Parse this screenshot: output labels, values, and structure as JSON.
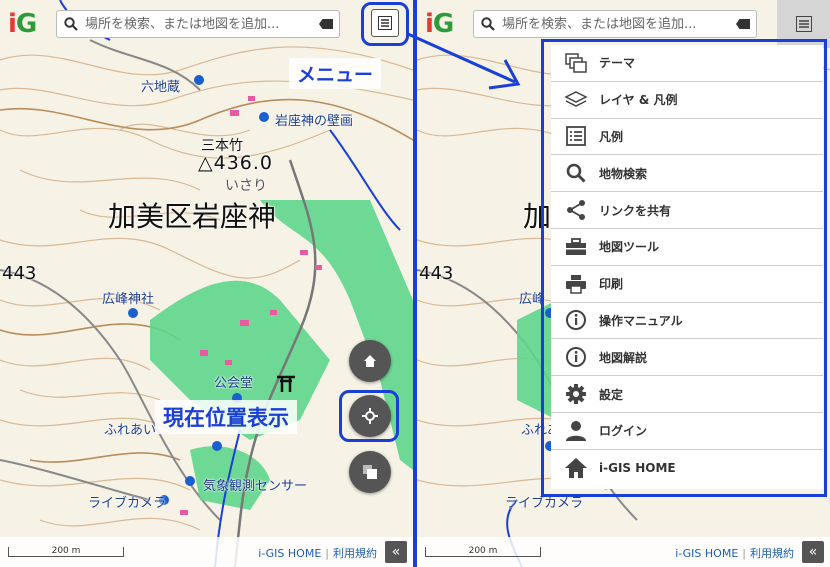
{
  "app": {
    "logo_i": "i",
    "logo_g": "G"
  },
  "search": {
    "placeholder": "場所を検索、または地図を追加..."
  },
  "annotations": {
    "menu_callout": "メニュー",
    "location_callout": "現在位置表示"
  },
  "map_labels": {
    "rokujizo": "六地蔵",
    "iwakura_wall": "岩座神の壁画",
    "sanbonchiku": "三本竹",
    "elevation": "△436.0",
    "isari": "いさり",
    "district": "加美区岩座神",
    "contour_443": "443",
    "hiromine": "広峰神社",
    "kominkan": "公会堂",
    "fureai": "ふれあい",
    "kisho": "気象観測センサー",
    "live_camera": "ライブカメラ",
    "right_district": "加",
    "right_hiromine": "広峰",
    "right_fureai": "ふれあ",
    "right_camera": "ライブカメラ"
  },
  "footer": {
    "scale": "200 m",
    "home_link": "i-GIS HOME",
    "terms_link": "利用規約",
    "collapse": "«"
  },
  "menu": {
    "items": [
      {
        "label": "テーマ",
        "icon": "layers-copy-icon"
      },
      {
        "label": "レイヤ & 凡例",
        "icon": "stack-layers-icon"
      },
      {
        "label": "凡例",
        "icon": "legend-list-icon"
      },
      {
        "label": "地物検索",
        "icon": "search-icon"
      },
      {
        "label": "リンクを共有",
        "icon": "share-icon"
      },
      {
        "label": "地図ツール",
        "icon": "toolbox-icon"
      },
      {
        "label": "印刷",
        "icon": "printer-icon"
      },
      {
        "label": "操作マニュアル",
        "icon": "info-icon"
      },
      {
        "label": "地図解説",
        "icon": "info-icon"
      },
      {
        "label": "設定",
        "icon": "gear-icon"
      },
      {
        "label": "ログイン",
        "icon": "user-icon"
      },
      {
        "label": "i-GIS HOME",
        "icon": "home-icon"
      }
    ]
  },
  "colors": {
    "highlight": "#1a3fd6",
    "forest": "#5fd68c",
    "map_bg": "#f6f2e6",
    "button": "#555555"
  }
}
